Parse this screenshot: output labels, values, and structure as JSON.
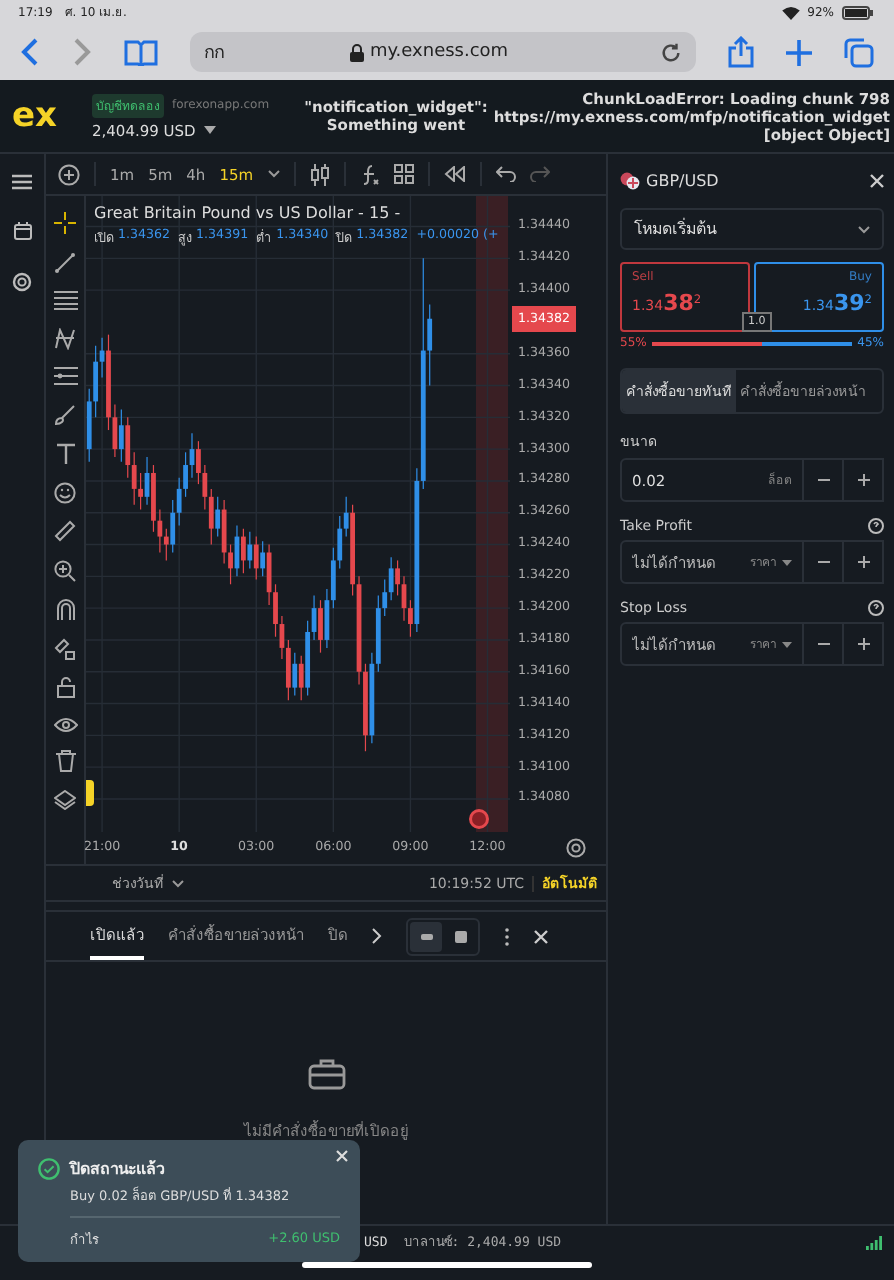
{
  "device_status": {
    "time": "17:19",
    "date": "ศ. 10 เม.ย.",
    "battery": "92%"
  },
  "browser": {
    "address_prefix": "กก",
    "url": "my.exness.com"
  },
  "header": {
    "logo": "ex",
    "account_badge": "บัญชีทดลอง",
    "domain": "forexonapp.com",
    "balance": "2,404.99 USD",
    "error_center": [
      "\"notification_widget\":",
      "Something went"
    ],
    "error_right": [
      "ChunkLoadError: Loading chunk 798",
      "https://my.exness.com/mfp/notification_widget",
      "[object Object]"
    ]
  },
  "chart_toolbar": {
    "timeframes": [
      {
        "label": "1m",
        "selected": false
      },
      {
        "label": "5m",
        "selected": false
      },
      {
        "label": "4h",
        "selected": false
      },
      {
        "label": "15m",
        "selected": true
      }
    ]
  },
  "chart": {
    "title": "Great Britain Pound vs US Dollar - 15 -",
    "ohlc": [
      {
        "label": "เปิด",
        "value": "1.34362"
      },
      {
        "label": "สูง",
        "value": "1.34391"
      },
      {
        "label": "ต่ำ",
        "value": "1.34340"
      },
      {
        "label": "ปิด",
        "value": "1.34382"
      }
    ],
    "change": "+0.00020 (+",
    "chart_data": {
      "type": "candlestick",
      "categories": [
        null,
        null,
        null,
        null,
        null,
        null,
        null,
        null,
        null,
        null,
        null,
        null,
        null,
        null,
        null,
        null,
        null,
        null,
        null,
        null,
        null,
        null,
        null,
        null,
        null,
        null,
        null,
        null,
        null,
        null,
        null,
        null,
        null,
        null,
        null,
        null,
        null,
        null,
        null,
        null,
        null,
        null,
        null,
        null,
        null,
        null,
        null,
        null,
        null,
        null,
        null,
        null,
        null,
        null,
        null,
        null,
        null,
        null,
        null,
        null,
        null,
        null,
        null,
        null,
        null,
        null
      ],
      "ohlc": [
        [
          1.343,
          1.34338,
          1.34292,
          1.3433
        ],
        [
          1.3433,
          1.34365,
          1.3432,
          1.34355
        ],
        [
          1.34355,
          1.3437,
          1.34345,
          1.34362
        ],
        [
          1.34362,
          1.34372,
          1.34312,
          1.3432
        ],
        [
          1.3432,
          1.34328,
          1.34295,
          1.343
        ],
        [
          1.343,
          1.34325,
          1.34292,
          1.34315
        ],
        [
          1.34315,
          1.3432,
          1.34282,
          1.3429
        ],
        [
          1.3429,
          1.34298,
          1.34265,
          1.34275
        ],
        [
          1.34275,
          1.34285,
          1.34262,
          1.3427
        ],
        [
          1.3427,
          1.34295,
          1.34265,
          1.34285
        ],
        [
          1.34285,
          1.3429,
          1.34248,
          1.34255
        ],
        [
          1.34255,
          1.34262,
          1.34235,
          1.34245
        ],
        [
          1.34245,
          1.3425,
          1.3423,
          1.3424
        ],
        [
          1.3424,
          1.34268,
          1.34235,
          1.3426
        ],
        [
          1.3426,
          1.34282,
          1.34252,
          1.34275
        ],
        [
          1.34275,
          1.34298,
          1.3427,
          1.3429
        ],
        [
          1.3429,
          1.3431,
          1.34282,
          1.343
        ],
        [
          1.343,
          1.34305,
          1.34278,
          1.34285
        ],
        [
          1.34285,
          1.3429,
          1.34262,
          1.3427
        ],
        [
          1.3427,
          1.34275,
          1.3424,
          1.3425
        ],
        [
          1.3425,
          1.3427,
          1.34245,
          1.34262
        ],
        [
          1.34262,
          1.34268,
          1.34228,
          1.34235
        ],
        [
          1.34235,
          1.3424,
          1.34215,
          1.34225
        ],
        [
          1.34225,
          1.34252,
          1.3422,
          1.34245
        ],
        [
          1.34245,
          1.3425,
          1.34222,
          1.3423
        ],
        [
          1.3423,
          1.34248,
          1.34225,
          1.3424
        ],
        [
          1.3424,
          1.34245,
          1.34218,
          1.34225
        ],
        [
          1.34225,
          1.34242,
          1.3422,
          1.34235
        ],
        [
          1.34235,
          1.3424,
          1.34202,
          1.3421
        ],
        [
          1.3421,
          1.34215,
          1.34182,
          1.3419
        ],
        [
          1.3419,
          1.34195,
          1.34168,
          1.34175
        ],
        [
          1.34175,
          1.3418,
          1.34142,
          1.3415
        ],
        [
          1.3415,
          1.34172,
          1.34145,
          1.34165
        ],
        [
          1.34165,
          1.3417,
          1.34142,
          1.3415
        ],
        [
          1.3415,
          1.34192,
          1.34145,
          1.34185
        ],
        [
          1.34185,
          1.34208,
          1.3418,
          1.342
        ],
        [
          1.342,
          1.34205,
          1.34172,
          1.3418
        ],
        [
          1.3418,
          1.34212,
          1.34175,
          1.34205
        ],
        [
          1.34205,
          1.34238,
          1.342,
          1.3423
        ],
        [
          1.3423,
          1.34258,
          1.34225,
          1.3425
        ],
        [
          1.3425,
          1.3427,
          1.34245,
          1.3426
        ],
        [
          1.3426,
          1.34265,
          1.34208,
          1.34215
        ],
        [
          1.34215,
          1.3422,
          1.34152,
          1.3416
        ],
        [
          1.3416,
          1.34165,
          1.3411,
          1.3412
        ],
        [
          1.3412,
          1.34172,
          1.34115,
          1.34165
        ],
        [
          1.34165,
          1.34208,
          1.3416,
          1.342
        ],
        [
          1.342,
          1.34218,
          1.34195,
          1.3421
        ],
        [
          1.3421,
          1.34232,
          1.34205,
          1.34225
        ],
        [
          1.34225,
          1.3423,
          1.34208,
          1.34215
        ],
        [
          1.34215,
          1.3422,
          1.34192,
          1.342
        ],
        [
          1.342,
          1.34205,
          1.34182,
          1.3419
        ],
        [
          1.3419,
          1.34288,
          1.34185,
          1.3428
        ],
        [
          1.3428,
          1.3442,
          1.34275,
          1.34362
        ],
        [
          1.34362,
          1.34391,
          1.3434,
          1.34382
        ],
        null,
        null,
        null,
        null,
        null,
        null,
        null,
        null,
        null,
        null,
        null,
        null
      ],
      "ylim": [
        1.340592,
        1.344592
      ],
      "yticks": [
        {
          "value": 1.3444,
          "label": "1.34440"
        },
        {
          "value": 1.3442,
          "label": "1.34420"
        },
        {
          "value": 1.344,
          "label": "1.34400"
        },
        {
          "value": 1.3436,
          "label": "1.34360"
        },
        {
          "value": 1.3434,
          "label": "1.34340"
        },
        {
          "value": 1.3432,
          "label": "1.34320"
        },
        {
          "value": 1.343,
          "label": "1.34300"
        },
        {
          "value": 1.3428,
          "label": "1.34280"
        },
        {
          "value": 1.3426,
          "label": "1.34260"
        },
        {
          "value": 1.3424,
          "label": "1.34240"
        },
        {
          "value": 1.3422,
          "label": "1.34220"
        },
        {
          "value": 1.342,
          "label": "1.34200"
        },
        {
          "value": 1.3418,
          "label": "1.34180"
        },
        {
          "value": 1.3416,
          "label": "1.34160"
        },
        {
          "value": 1.3414,
          "label": "1.34140"
        },
        {
          "value": 1.3412,
          "label": "1.34120"
        },
        {
          "value": 1.341,
          "label": "1.34100"
        },
        {
          "value": 1.3408,
          "label": "1.34080"
        }
      ],
      "grid": true
    },
    "time_ticks": [
      {
        "label": "21:00",
        "kind": "time"
      },
      {
        "label": "10",
        "kind": "day"
      },
      {
        "label": "03:00",
        "kind": "time"
      },
      {
        "label": "06:00",
        "kind": "time"
      },
      {
        "label": "09:00",
        "kind": "time"
      },
      {
        "label": "12:00",
        "kind": "time"
      }
    ],
    "current_price": "1.34382",
    "range_label": "ช่วงวันที่",
    "clock": "10:19:52 UTC",
    "scale_mode": "อัตโนมัติ"
  },
  "order_panel": {
    "symbol": "GBP/USD",
    "mode": "โหมดเริ่มต้น",
    "sell": {
      "label": "Sell",
      "price": "1.34**38**$^{2}$"
    },
    "buy": {
      "label": "Buy",
      "price": "1.34**39**$^{2}$"
    },
    "spread": "1.0",
    "sentiment": {
      "sell_share": "55%",
      "buy_share": "45%",
      "level": 0.55
    },
    "order_tabs": [
      {
        "label": "คำสั่งซื้อขายทันที",
        "selected": true
      },
      {
        "label": "คำสั่งซื้อขายล่วงหน้า",
        "selected": false
      }
    ],
    "fields": [
      {
        "label": "ขนาด",
        "value": "0.02",
        "unit": "ล็อต",
        "kind": "unit",
        "help": false
      },
      {
        "label": "Take Profit",
        "placeholder": "ไม่ได้กำหนด",
        "unit": "ราคา",
        "kind": "dropdown",
        "help": true
      },
      {
        "label": "Stop Loss",
        "placeholder": "ไม่ได้กำหนด",
        "unit": "ราคา",
        "kind": "dropdown",
        "help": true
      }
    ]
  },
  "positions": {
    "tabs": [
      {
        "label": "เปิดแล้ว",
        "selected": true
      },
      {
        "label": "คำสั่งซื้อขายล่วงหน้า",
        "selected": false
      },
      {
        "label": "ปิด",
        "selected": false
      }
    ],
    "view_toggle": [
      {
        "selected": true
      },
      {
        "selected": false
      }
    ],
    "empty_message": "ไม่มีคำสั่งซื้อขายที่เปิดอยู่"
  },
  "footer": {
    "currency": "USD",
    "balance": "บาลานซ์: 2,404.99 USD"
  },
  "toast": {
    "title": "ปิดสถานะแล้ว",
    "detail": "Buy 0.02 ล็อต GBP/USD ที่ 1.34382",
    "profit_label": "กำไร",
    "profit": "+2.60 USD"
  }
}
